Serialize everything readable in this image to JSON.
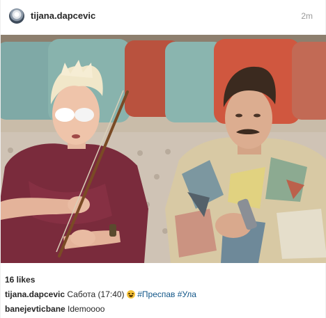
{
  "header": {
    "username": "tijana.dapcevic",
    "timestamp": "2m"
  },
  "photo": {
    "alt": ""
  },
  "likes": "16 likes",
  "caption": {
    "username": "tijana.dapcevic",
    "text": "Сабота (17:40)",
    "emoji": "laughing-face-icon",
    "hashtags": [
      "#Преспав",
      "#Ула"
    ]
  },
  "comment": {
    "username": "banejevticbane",
    "text": "Idemoooo"
  },
  "colors": {
    "text": "#262626",
    "muted": "#999999",
    "hashtag": "#125688"
  }
}
